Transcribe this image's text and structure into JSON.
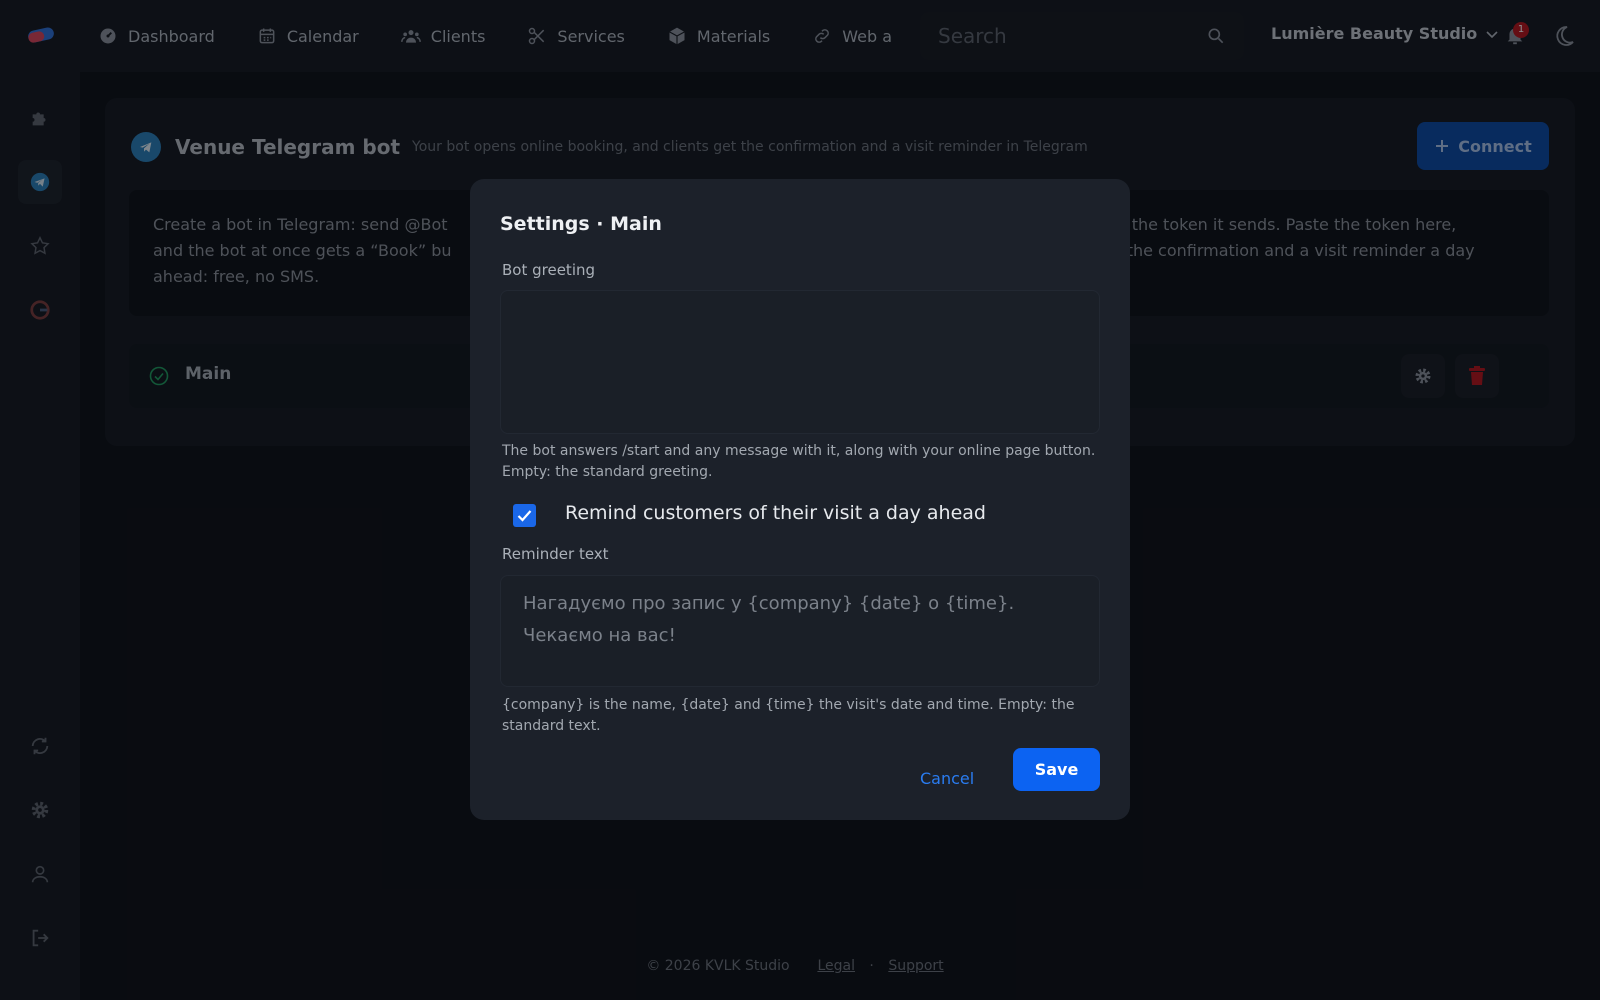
{
  "nav": {
    "items": [
      {
        "label": "Dashboard",
        "icon": "gauge-icon"
      },
      {
        "label": "Calendar",
        "icon": "calendar-icon"
      },
      {
        "label": "Clients",
        "icon": "users-icon"
      },
      {
        "label": "Services",
        "icon": "scissors-icon"
      },
      {
        "label": "Materials",
        "icon": "box-icon"
      },
      {
        "label": "Web a",
        "icon": "link-icon"
      }
    ],
    "search_placeholder": "Search",
    "studio_name": "Lumière Beauty Studio",
    "notification_count": "1"
  },
  "sidebar": {
    "items": [
      "puzzle-icon",
      "telegram-icon",
      "star-icon",
      "google-icon",
      "refresh-icon",
      "gear-icon",
      "user-icon",
      "logout-icon"
    ],
    "active": "telegram-icon"
  },
  "card": {
    "title": "Venue Telegram bot",
    "subtitle": "Your bot opens online booking, and clients get the confirmation and a visit reminder in Telegram",
    "connect_label": "Connect",
    "info_left_1": "Create a bot in Telegram: send @Bot",
    "info_left_2": "and the bot at once gets a “Book” bu",
    "info_left_3": "ahead: free, no SMS.",
    "info_right_1": "py the token it sends. Paste the token here,",
    "info_right_2": "ts the confirmation and a visit reminder a day",
    "bot_name": "Main"
  },
  "modal": {
    "title": "Settings · Main",
    "greeting_label": "Bot greeting",
    "greeting_value": "",
    "greeting_hint": "The bot answers /start and any message with it, along with your online page button. Empty: the standard greeting.",
    "reminder_checkbox_label": "Remind customers of their visit a day ahead",
    "reminder_checked": true,
    "reminder_label": "Reminder text",
    "reminder_placeholder": "Нагадуємо про запис у {company} {date} о {time}. Чекаємо на вас!",
    "reminder_hint": "{company} is the name, {date} and {time} the visit's date and time. Empty: the standard text.",
    "cancel_label": "Cancel",
    "save_label": "Save"
  },
  "footer": {
    "copyright": "© 2026 KVLK Studio",
    "legal": "Legal",
    "separator": "·",
    "support": "Support"
  },
  "colors": {
    "accent": "#0c63f2",
    "danger": "#b5141c",
    "success": "#1fa463",
    "telegram": "#2a7fb8"
  }
}
